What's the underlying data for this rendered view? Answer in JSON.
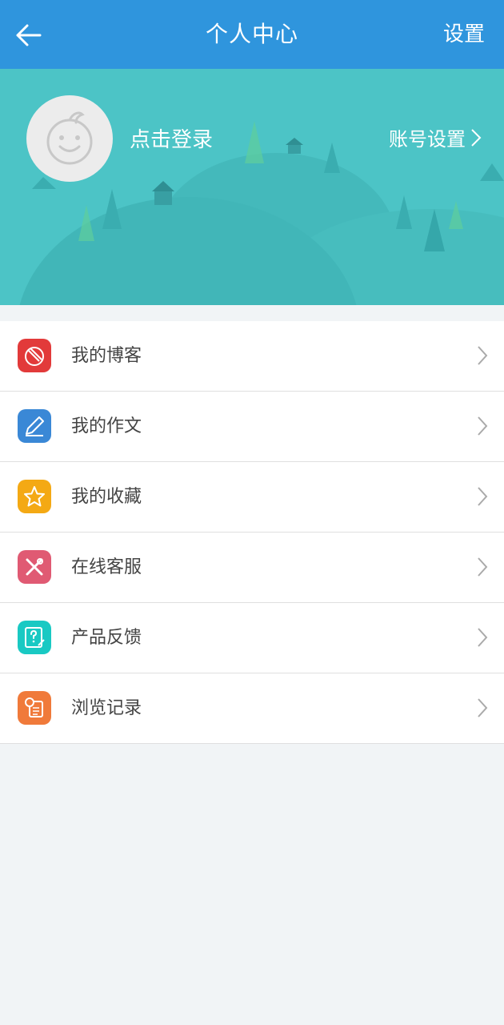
{
  "header": {
    "title": "个人中心",
    "settings_label": "设置",
    "back_icon": "arrow-left-icon"
  },
  "profile": {
    "login_label": "点击登录",
    "account_settings_label": "账号设置",
    "avatar_icon": "smiley-face-icon"
  },
  "menu": {
    "items": [
      {
        "label": "我的博客",
        "icon": "blog-icon",
        "color": "#e23a3a"
      },
      {
        "label": "我的作文",
        "icon": "pencil-icon",
        "color": "#3a88d6"
      },
      {
        "label": "我的收藏",
        "icon": "star-icon",
        "color": "#f4a914"
      },
      {
        "label": "在线客服",
        "icon": "tools-icon",
        "color": "#e05a73"
      },
      {
        "label": "产品反馈",
        "icon": "feedback-icon",
        "color": "#19c9c3"
      },
      {
        "label": "浏览记录",
        "icon": "history-icon",
        "color": "#f07a3a"
      }
    ]
  },
  "colors": {
    "topbar": "#2f95dd",
    "banner": "#4cc4c6",
    "page_background": "#f1f4f6"
  }
}
